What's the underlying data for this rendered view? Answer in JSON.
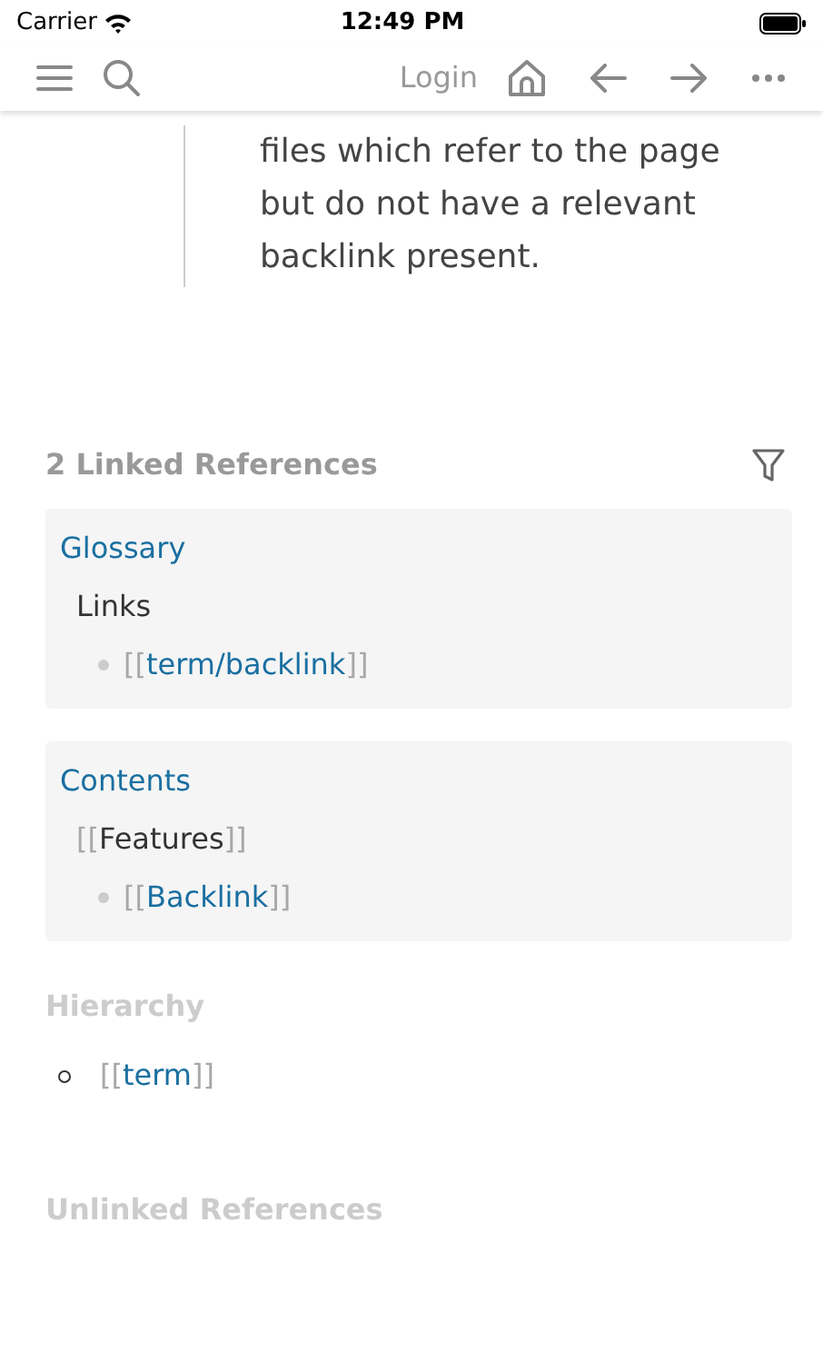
{
  "status_bar": {
    "carrier": "Carrier",
    "time": "12:49 PM"
  },
  "toolbar": {
    "login": "Login"
  },
  "quote": {
    "text": "files which refer to the page but do not have a relevant backlink present."
  },
  "linked_references": {
    "title": "2 Linked References",
    "groups": [
      {
        "title": "Glossary",
        "heading": {
          "text": "Links",
          "link": false
        },
        "items": [
          {
            "open": "[[",
            "text": "term/backlink",
            "close": "]]",
            "link": true
          }
        ]
      },
      {
        "title": "Contents",
        "heading": {
          "open": "[[",
          "text": "Features",
          "close": "]]",
          "link": false
        },
        "items": [
          {
            "open": "[[",
            "text": "Backlink",
            "close": "]]",
            "link": true
          }
        ]
      }
    ]
  },
  "hierarchy": {
    "title": "Hierarchy",
    "items": [
      {
        "open": "[[",
        "text": "term",
        "close": "]]",
        "link": true
      }
    ]
  },
  "unlinked_references": {
    "title": "Unlinked References"
  }
}
